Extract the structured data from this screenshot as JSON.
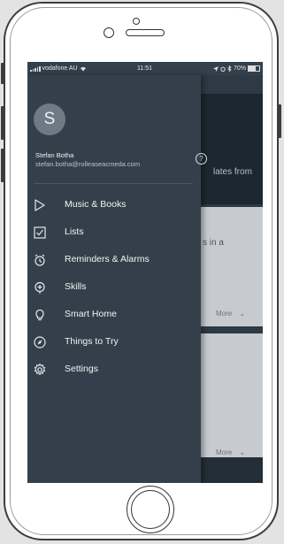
{
  "status_bar": {
    "carrier": "vodafone AU",
    "time": "11:51",
    "battery": "70%",
    "battery_level": 0.7
  },
  "user": {
    "avatar_initial": "S",
    "name": "Stefan Botha",
    "email": "stefan.botha@rolleaseacmeda.com",
    "help_label": "?"
  },
  "menu": {
    "items": [
      {
        "label": "Music & Books",
        "icon": "play-icon"
      },
      {
        "label": "Lists",
        "icon": "checkbox-icon"
      },
      {
        "label": "Reminders & Alarms",
        "icon": "alarm-clock-icon"
      },
      {
        "label": "Skills",
        "icon": "skills-icon"
      },
      {
        "label": "Smart Home",
        "icon": "lightbulb-icon"
      },
      {
        "label": "Things to Try",
        "icon": "compass-icon"
      },
      {
        "label": "Settings",
        "icon": "gear-icon"
      }
    ]
  },
  "background": {
    "text1": "lates from",
    "text2": "s in a",
    "more_label_1": "More",
    "more_label_2": "More"
  },
  "colors": {
    "drawer_bg": "#33404b",
    "avatar_bg": "#6e7b86",
    "card_bg": "#c7cbcf"
  }
}
